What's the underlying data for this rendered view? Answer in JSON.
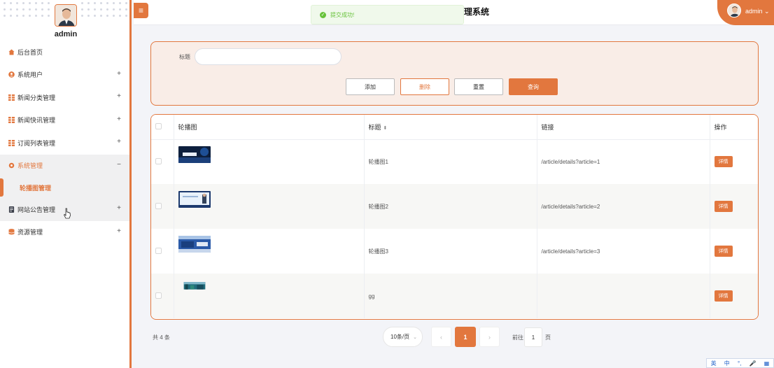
{
  "sidebar": {
    "username": "admin",
    "menu": [
      {
        "label": "后台首页",
        "icon": "home-icon",
        "expand": ""
      },
      {
        "label": "系统用户",
        "icon": "user-icon",
        "expand": "+"
      },
      {
        "label": "新闻分类管理",
        "icon": "grid-icon",
        "expand": "+"
      },
      {
        "label": "新闻快讯管理",
        "icon": "grid-icon",
        "expand": "+"
      },
      {
        "label": "订阅列表管理",
        "icon": "grid-icon",
        "expand": "+"
      },
      {
        "label": "系统管理",
        "icon": "gear-icon",
        "expand": "−"
      },
      {
        "label": "网站公告管理",
        "icon": "document-icon",
        "expand": "+"
      },
      {
        "label": "资源管理",
        "icon": "database-icon",
        "expand": "+"
      }
    ],
    "submenu_active": "轮播图管理"
  },
  "header": {
    "toggle_icon": "≡",
    "title_fragment": "理系统",
    "user_name": "admin"
  },
  "toast": {
    "message": "提交成功!"
  },
  "search": {
    "title_label": "标题",
    "title_value": "",
    "buttons": {
      "add": "添加",
      "delete": "删除",
      "reset": "重置",
      "query": "查询"
    }
  },
  "table": {
    "columns": [
      "",
      "轮播图",
      "标题",
      "链接",
      "操作"
    ],
    "rows": [
      {
        "image": "thumb-1",
        "title": "轮播图1",
        "link": "/article/details?article=1",
        "action": "详情"
      },
      {
        "image": "thumb-2",
        "title": "轮播图2",
        "link": "/article/details?article=2",
        "action": "详情"
      },
      {
        "image": "thumb-3",
        "title": "轮播图3",
        "link": "/article/details?article=3",
        "action": "详情"
      },
      {
        "image": "thumb-4",
        "title": "gg",
        "link": "",
        "action": "详情"
      }
    ]
  },
  "pagination": {
    "total": "共 4 条",
    "page_size": "10条/页",
    "prev": "‹",
    "current": "1",
    "next": "›",
    "goto_label": "前往",
    "goto_value": "1",
    "goto_unit": "页"
  },
  "ime": {
    "items": [
      "英",
      "中",
      "°,",
      "🎤",
      "▦"
    ]
  },
  "colors": {
    "accent": "#e2773e",
    "success": "#67c23a"
  }
}
